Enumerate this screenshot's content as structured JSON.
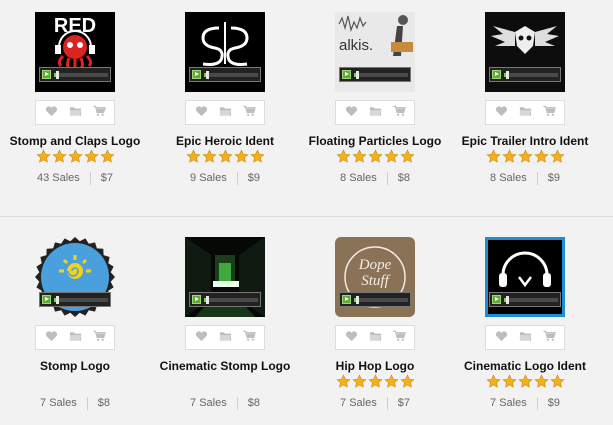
{
  "colors": {
    "star": "#f2b01e",
    "play": "#62a83a",
    "progress": "#6fd34b",
    "icon": "#bdbdbd"
  },
  "rating_max": 5,
  "items": [
    {
      "title": "Stomp and Claps Logo",
      "sales": "43 Sales",
      "price": "$7",
      "rating": 5,
      "thumb": "red-octopus",
      "thumb_text": "RED",
      "progress": 0.06
    },
    {
      "title": "Epic Heroic Ident",
      "sales": "9 Sales",
      "price": "$9",
      "rating": 5,
      "thumb": "mirrored-s",
      "thumb_text": "",
      "progress": 0.06
    },
    {
      "title": "Floating Particles Logo",
      "sales": "8 Sales",
      "price": "$8",
      "rating": 5,
      "thumb": "alkis-photo",
      "thumb_text": "alkis.",
      "progress": 0.06
    },
    {
      "title": "Epic Trailer Intro Ident",
      "sales": "8 Sales",
      "price": "$9",
      "rating": 5,
      "thumb": "winged-skull",
      "thumb_text": "",
      "progress": 0.06
    },
    {
      "title": "Stomp Logo",
      "sales": "7 Sales",
      "price": "$8",
      "rating": 0,
      "thumb": "sun-badge",
      "thumb_text": "",
      "progress": 0.06
    },
    {
      "title": "Cinematic Stomp Logo",
      "sales": "7 Sales",
      "price": "$8",
      "rating": 0,
      "thumb": "green-corridor",
      "thumb_text": "",
      "progress": 0.06
    },
    {
      "title": "Hip Hop Logo",
      "sales": "7 Sales",
      "price": "$7",
      "rating": 5,
      "thumb": "dope-stuff",
      "thumb_text": "Dope Stuff",
      "progress": 0.06
    },
    {
      "title": "Cinematic Logo Ident",
      "sales": "7 Sales",
      "price": "$9",
      "rating": 5,
      "thumb": "headphones-logo",
      "thumb_text": "",
      "progress": 0.06
    }
  ],
  "icons": {
    "wishlist": "heart-icon",
    "collection": "folder-icon",
    "cart": "cart-icon",
    "play": "play-icon"
  }
}
